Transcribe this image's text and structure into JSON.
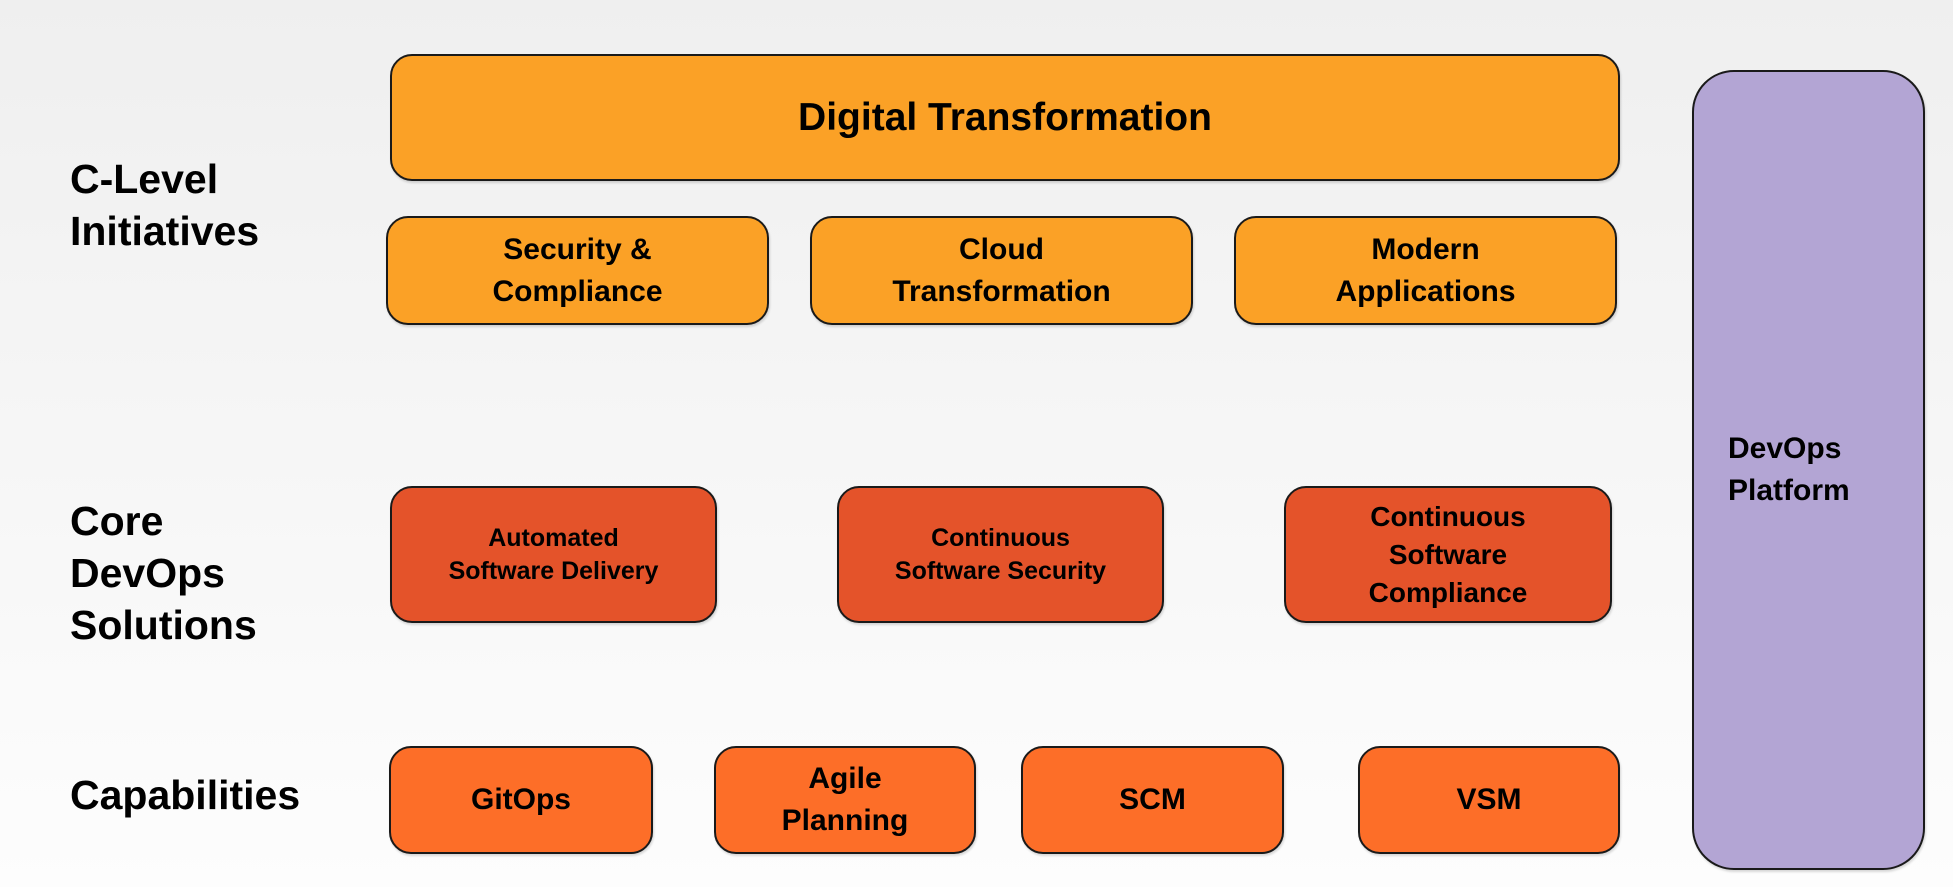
{
  "row_labels": {
    "c_level": "C-Level\nInitiatives",
    "core": " Core\nDevOps\nSolutions",
    "capabilities": "Capabilities"
  },
  "initiatives": {
    "main": "Digital Transformation",
    "items": [
      "Security &\nCompliance",
      "Cloud\nTransformation",
      "Modern\nApplications"
    ]
  },
  "solutions": [
    "Automated\nSoftware Delivery",
    "Continuous\nSoftware Security",
    "Continuous\nSoftware\nCompliance"
  ],
  "capabilities": [
    "GitOps",
    "Agile\nPlanning",
    "SCM",
    "VSM"
  ],
  "platform": {
    "label": "DevOps\nPlatform"
  },
  "colors": {
    "initiative": "#fba126",
    "solution": "#e4532a",
    "capability": "#fd6e28",
    "platform": "#b3a5d4",
    "background": "#f3f3f3"
  }
}
